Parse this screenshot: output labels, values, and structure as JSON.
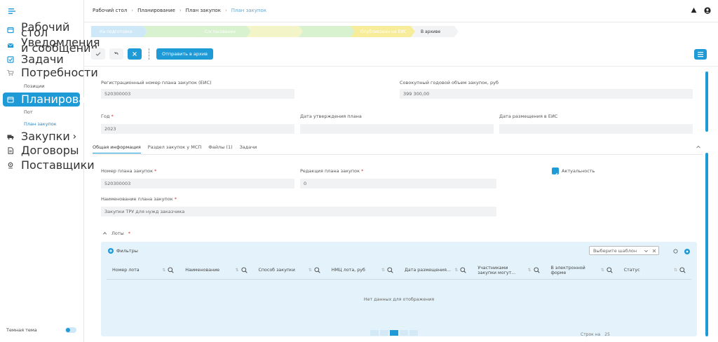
{
  "sidebar": {
    "items": [
      {
        "label": "Рабочий стол",
        "icon": "home-icon"
      },
      {
        "label": "Уведомления и сообщения",
        "icon": "mail-icon"
      },
      {
        "label": "Задачи",
        "icon": "checkbox-icon"
      },
      {
        "label": "Потребности",
        "icon": "cart-icon"
      },
      {
        "label": "Планирование",
        "icon": "calendar-icon"
      },
      {
        "label": "Закупки",
        "icon": "truck-icon"
      },
      {
        "label": "Договоры",
        "icon": "contract-icon"
      },
      {
        "label": "Поставщики",
        "icon": "location-icon"
      }
    ],
    "sub_needs": [
      "Позиции"
    ],
    "sub_planning": [
      "Пот",
      "План закупок"
    ],
    "theme_label": "Темная тема"
  },
  "breadcrumb": [
    "Рабочий стол",
    "Планирование",
    "План закупок",
    "План закупок"
  ],
  "stages": [
    {
      "label": "На подготовке",
      "bg": "#cfe8f7",
      "color": "#fff"
    },
    {
      "label": "",
      "bg": "#d8f1cf",
      "color": "#fff"
    },
    {
      "label": "Согласование",
      "bg": "#d8f1cf",
      "color": "#fff"
    },
    {
      "label": "",
      "bg": "#f3f5c8",
      "color": "#fff"
    },
    {
      "label": "",
      "bg": "#d8f1cf",
      "color": "#fff"
    },
    {
      "label": "Опубликован на ЕИС",
      "bg": "#f7ec9a",
      "color": "#fff"
    },
    {
      "label": "В архиве",
      "bg": "#f2f3f5",
      "color": "#333"
    }
  ],
  "toolbar": {
    "archive_label": "Отправить в архив"
  },
  "header_form": {
    "reg_label": "Регистрационный номер плана закупок (ЕИС)",
    "reg_value": "520300003",
    "volume_label": "Совокупный годовой объем закупок, руб",
    "volume_value": "399 300,00",
    "year_label": "Год",
    "year_value": "2023",
    "approved_label": "Дата утверждения плана",
    "placed_label": "Дата размещения в ЕИС"
  },
  "tabs": [
    "Общая информация",
    "Раздел закупок у МСП",
    "Файлы (1)",
    "Задачи"
  ],
  "general": {
    "plan_number_label": "Номер плана закупок",
    "plan_number_value": "520300003",
    "revision_label": "Редакция плана закупок",
    "revision_value": "0",
    "actual_label": "Актуальность",
    "plan_name_label": "Наименование плана закупок",
    "plan_name_value": "Закупки ТРУ для нужд заказчика",
    "lots_label": "Лоты"
  },
  "grid": {
    "filter_label": "Фильтры",
    "template_placeholder": "Выберите шаблон",
    "columns": [
      "Номер лота",
      "Наименование",
      "Способ закупки",
      "НМЦ лота, руб",
      "Дата размещения...",
      "Участниками закупки могут...",
      "В электронной форме",
      "Статус"
    ],
    "empty_text": "Нет данных для отображения",
    "per_page_label": "Строк на",
    "per_page_value": "25"
  },
  "colors": {
    "accent": "#1e9bd7"
  }
}
